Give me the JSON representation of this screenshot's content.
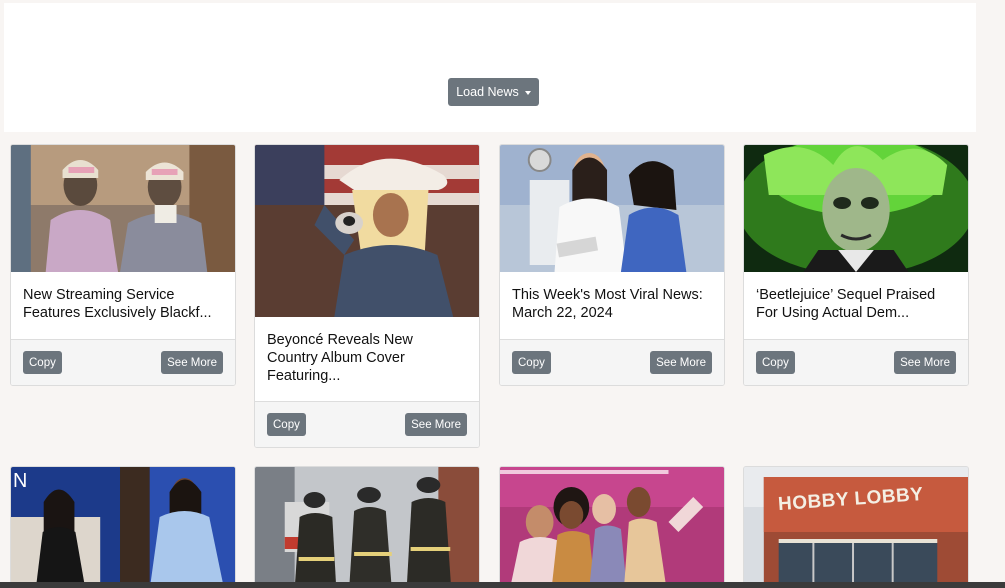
{
  "header": {
    "load_button_label": "Load News"
  },
  "cards": [
    {
      "title": "New Streaming Service Features Exclusively Blackf...",
      "copy_label": "Copy",
      "more_label": "See More"
    },
    {
      "title": "Beyoncé Reveals New Country Album Cover Featuring...",
      "copy_label": "Copy",
      "more_label": "See More"
    },
    {
      "title": "This Week's Most Viral News: March 22, 2024",
      "copy_label": "Copy",
      "more_label": "See More"
    },
    {
      "title": "‘Beetlejuice’ Sequel Praised For Using Actual Dem...",
      "copy_label": "Copy",
      "more_label": "See More"
    }
  ],
  "hobby_lobby_sign": "HOBBY LOBBY"
}
